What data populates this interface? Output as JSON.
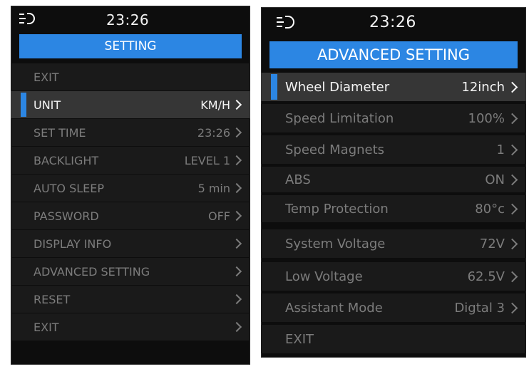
{
  "colors": {
    "accent": "#2c86e3",
    "screen_bg": "#0d0d0d",
    "selected_row": "#363636",
    "text_active": "#f5f5f5",
    "text_inactive": "#7c7c7c"
  },
  "left": {
    "status": {
      "icon": "headlight-icon",
      "time": "23:26"
    },
    "title": "SETTING",
    "rows": [
      {
        "label": "EXIT",
        "value": ""
      },
      {
        "label": "UNIT",
        "value": "KM/H"
      },
      {
        "label": "SET TIME",
        "value": "23:26"
      },
      {
        "label": "BACKLIGHT",
        "value": "LEVEL 1"
      },
      {
        "label": "AUTO SLEEP",
        "value": "5 min"
      },
      {
        "label": "PASSWORD",
        "value": "OFF"
      },
      {
        "label": "DISPLAY INFO",
        "value": ""
      },
      {
        "label": "ADVANCED SETTING",
        "value": ""
      },
      {
        "label": "RESET",
        "value": ""
      },
      {
        "label": "EXIT",
        "value": ""
      }
    ]
  },
  "right": {
    "status": {
      "icon": "headlight-icon",
      "time": "23:26"
    },
    "title": "ADVANCED SETTING",
    "rows": [
      {
        "label": "Wheel Diameter",
        "value": "12inch"
      },
      {
        "label": "Speed Limitation",
        "value": "100%"
      },
      {
        "label": "Speed Magnets",
        "value": "1"
      },
      {
        "label": "ABS",
        "value": "ON"
      },
      {
        "label": "Temp Protection",
        "value": "80°c"
      },
      {
        "label": "System Voltage",
        "value": "72V"
      },
      {
        "label": "Low Voltage",
        "value": "62.5V"
      },
      {
        "label": "Assistant Mode",
        "value": "Digtal 3"
      },
      {
        "label": "EXIT",
        "value": ""
      }
    ]
  }
}
